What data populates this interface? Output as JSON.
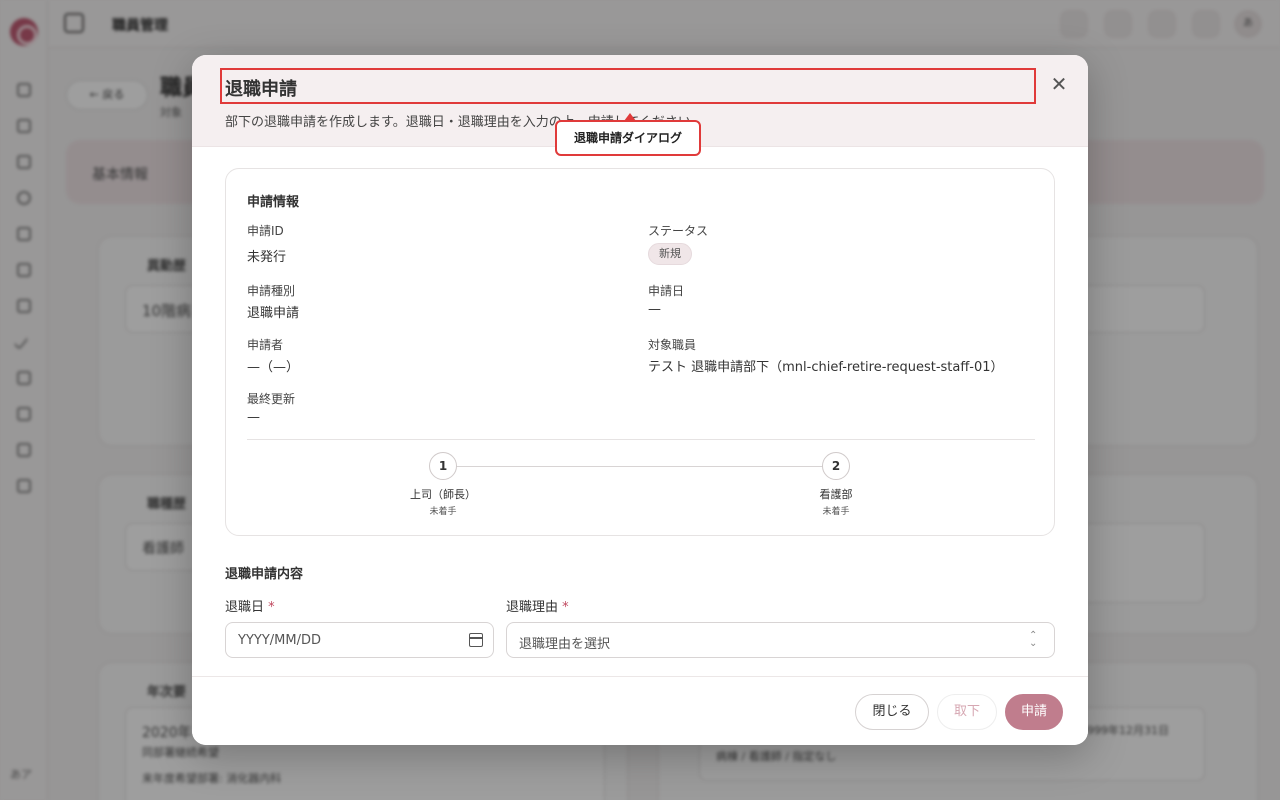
{
  "app": {
    "header_title": "職員管理",
    "back_label": "← 戻る",
    "page_title": "職員",
    "page_subtitle": "対象",
    "info_tab": "基本情報",
    "bg_section_1": "異動歴",
    "bg_value_1": "10階病",
    "bg_section_2": "職種歴",
    "bg_value_2": "看護師",
    "bg_section_3": "年次要",
    "bg_value_3a": "2020年",
    "bg_value_3b": "同部署継続希望",
    "bg_value_3c": "来年度希望部署: 消化器内科",
    "bg_right_text": "病棟 / 看護師 / 指定なし",
    "bg_right_date": "9999年12月31日",
    "sidebar_footer": "あア"
  },
  "dialog": {
    "title": "退職申請",
    "description": "部下の退職申請を作成します。退職日・退職理由を入力の上、申請してください。",
    "close_icon": "close-icon"
  },
  "info": {
    "section_title": "申請情報",
    "request_id_label": "申請ID",
    "request_id_value": "未発行",
    "status_label": "ステータス",
    "status_value": "新規",
    "request_type_label": "申請種別",
    "request_type_value": "退職申請",
    "request_date_label": "申請日",
    "request_date_value": "—",
    "applicant_label": "申請者",
    "applicant_value": "—（—）",
    "target_staff_label": "対象職員",
    "target_staff_value": "テスト 退職申請部下（mnl-chief-retire-request-staff-01）",
    "last_updated_label": "最終更新",
    "last_updated_value": "—"
  },
  "steps": [
    {
      "number": "1",
      "label": "上司（師長）",
      "status": "未着手"
    },
    {
      "number": "2",
      "label": "看護部",
      "status": "未着手"
    }
  ],
  "form": {
    "section_title": "退職申請内容",
    "retire_date_label": "退職日",
    "retire_date_placeholder": "YYYY/MM/DD",
    "reason_label": "退職理由",
    "reason_placeholder": "退職理由を選択",
    "required_mark": "*"
  },
  "footer": {
    "close_label": "閉じる",
    "withdraw_label": "取下",
    "submit_label": "申請"
  },
  "annotation": {
    "callout_text": "退職申請ダイアログ",
    "color": "#e03a3a"
  },
  "colors": {
    "accent": "#c07d8d",
    "header_bg": "#f5eff0",
    "required": "#c0475e"
  }
}
